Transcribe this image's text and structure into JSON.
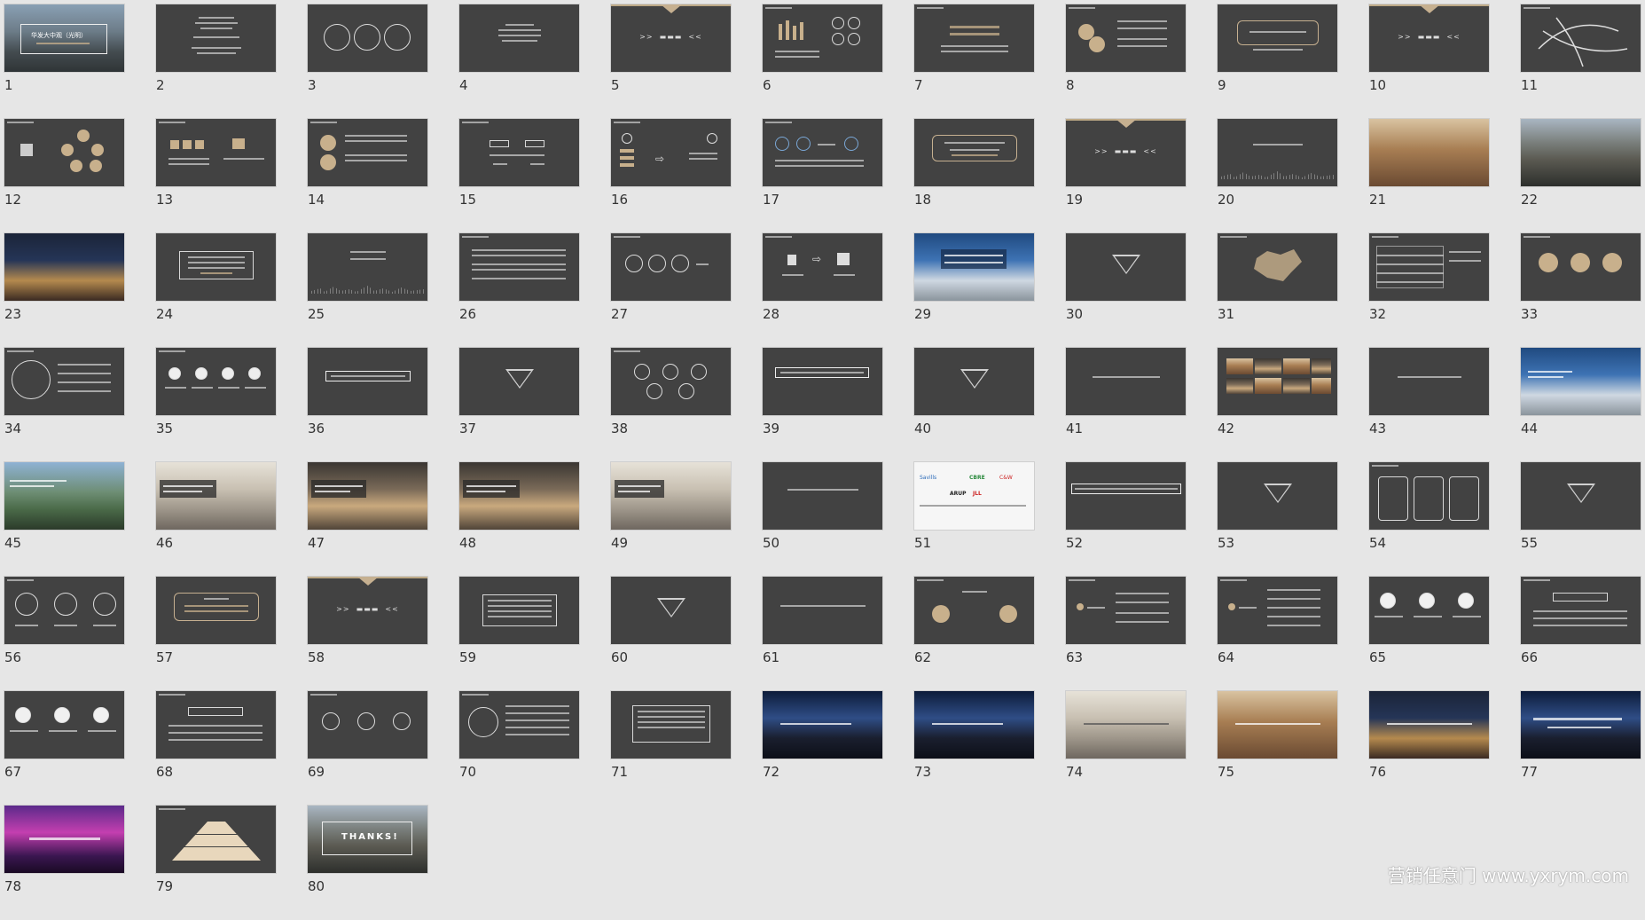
{
  "slides": [
    {
      "n": "1"
    },
    {
      "n": "2"
    },
    {
      "n": "3"
    },
    {
      "n": "4"
    },
    {
      "n": "5"
    },
    {
      "n": "6"
    },
    {
      "n": "7"
    },
    {
      "n": "8"
    },
    {
      "n": "9"
    },
    {
      "n": "10"
    },
    {
      "n": "11"
    },
    {
      "n": "12"
    },
    {
      "n": "13"
    },
    {
      "n": "14"
    },
    {
      "n": "15"
    },
    {
      "n": "16"
    },
    {
      "n": "17"
    },
    {
      "n": "18"
    },
    {
      "n": "19"
    },
    {
      "n": "20"
    },
    {
      "n": "21"
    },
    {
      "n": "22"
    },
    {
      "n": "23"
    },
    {
      "n": "24"
    },
    {
      "n": "25"
    },
    {
      "n": "26"
    },
    {
      "n": "27"
    },
    {
      "n": "28"
    },
    {
      "n": "29"
    },
    {
      "n": "30"
    },
    {
      "n": "31"
    },
    {
      "n": "32"
    },
    {
      "n": "33"
    },
    {
      "n": "34"
    },
    {
      "n": "35"
    },
    {
      "n": "36"
    },
    {
      "n": "37"
    },
    {
      "n": "38"
    },
    {
      "n": "39"
    },
    {
      "n": "40"
    },
    {
      "n": "41"
    },
    {
      "n": "42"
    },
    {
      "n": "43"
    },
    {
      "n": "44"
    },
    {
      "n": "45"
    },
    {
      "n": "46"
    },
    {
      "n": "47"
    },
    {
      "n": "48"
    },
    {
      "n": "49"
    },
    {
      "n": "50"
    },
    {
      "n": "51"
    },
    {
      "n": "52"
    },
    {
      "n": "53"
    },
    {
      "n": "54"
    },
    {
      "n": "55"
    },
    {
      "n": "56"
    },
    {
      "n": "57"
    },
    {
      "n": "58"
    },
    {
      "n": "59"
    },
    {
      "n": "60"
    },
    {
      "n": "61"
    },
    {
      "n": "62"
    },
    {
      "n": "63"
    },
    {
      "n": "64"
    },
    {
      "n": "65"
    },
    {
      "n": "66"
    },
    {
      "n": "67"
    },
    {
      "n": "68"
    },
    {
      "n": "69"
    },
    {
      "n": "70"
    },
    {
      "n": "71"
    },
    {
      "n": "72"
    },
    {
      "n": "73"
    },
    {
      "n": "74"
    },
    {
      "n": "75"
    },
    {
      "n": "76"
    },
    {
      "n": "77"
    },
    {
      "n": "78"
    },
    {
      "n": "79"
    },
    {
      "n": "80"
    }
  ],
  "thumb_text": {
    "s1_title": "华发大中观（光明）",
    "s80_thanks": "THANKS!",
    "s51_logos": [
      "Savills",
      "CBRE",
      "ARUP",
      "JLL",
      "C&W"
    ]
  },
  "watermark": "营销任意门 www.yxrym.com",
  "colors": {
    "slide_bg": "#424242",
    "page_bg": "#e6e6e6",
    "accent_gold": "#c8b08c"
  }
}
